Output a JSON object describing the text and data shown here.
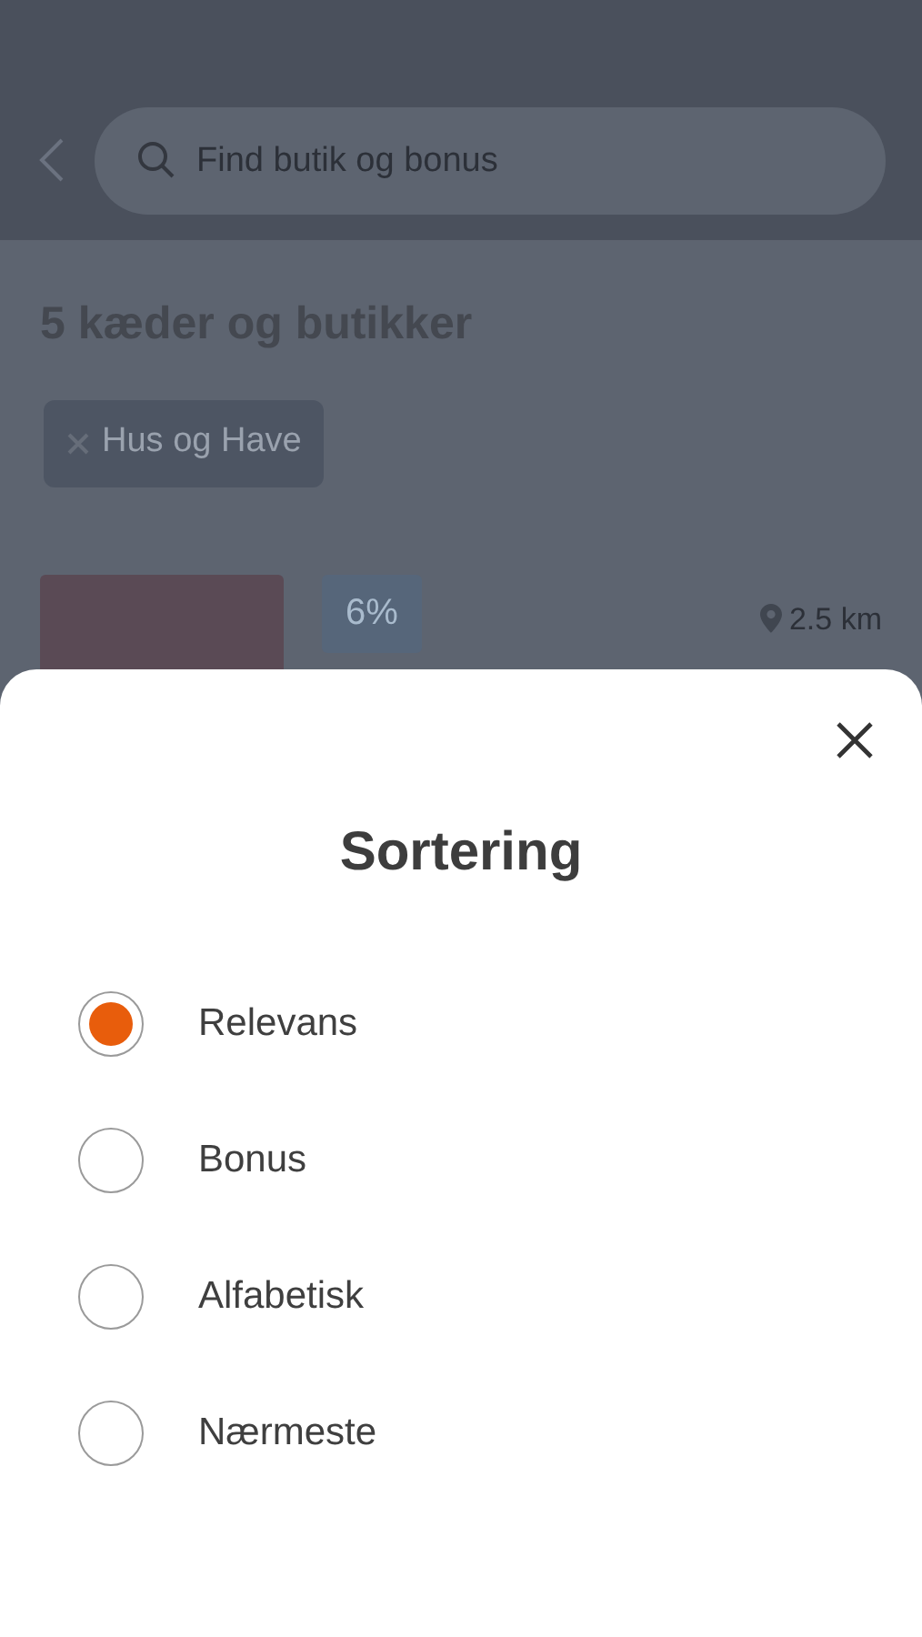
{
  "header": {
    "search": {
      "placeholder": "Find butik og bonus"
    }
  },
  "results_title": "5 kæder og butikker",
  "filters": [
    {
      "label": "Hus og Have"
    }
  ],
  "store": {
    "bonus": "6%",
    "distance": "2.5 km"
  },
  "sheet": {
    "title": "Sortering",
    "options": [
      {
        "label": "Relevans",
        "selected": true
      },
      {
        "label": "Bonus",
        "selected": false
      },
      {
        "label": "Alfabetisk",
        "selected": false
      },
      {
        "label": "Nærmeste",
        "selected": false
      }
    ]
  }
}
